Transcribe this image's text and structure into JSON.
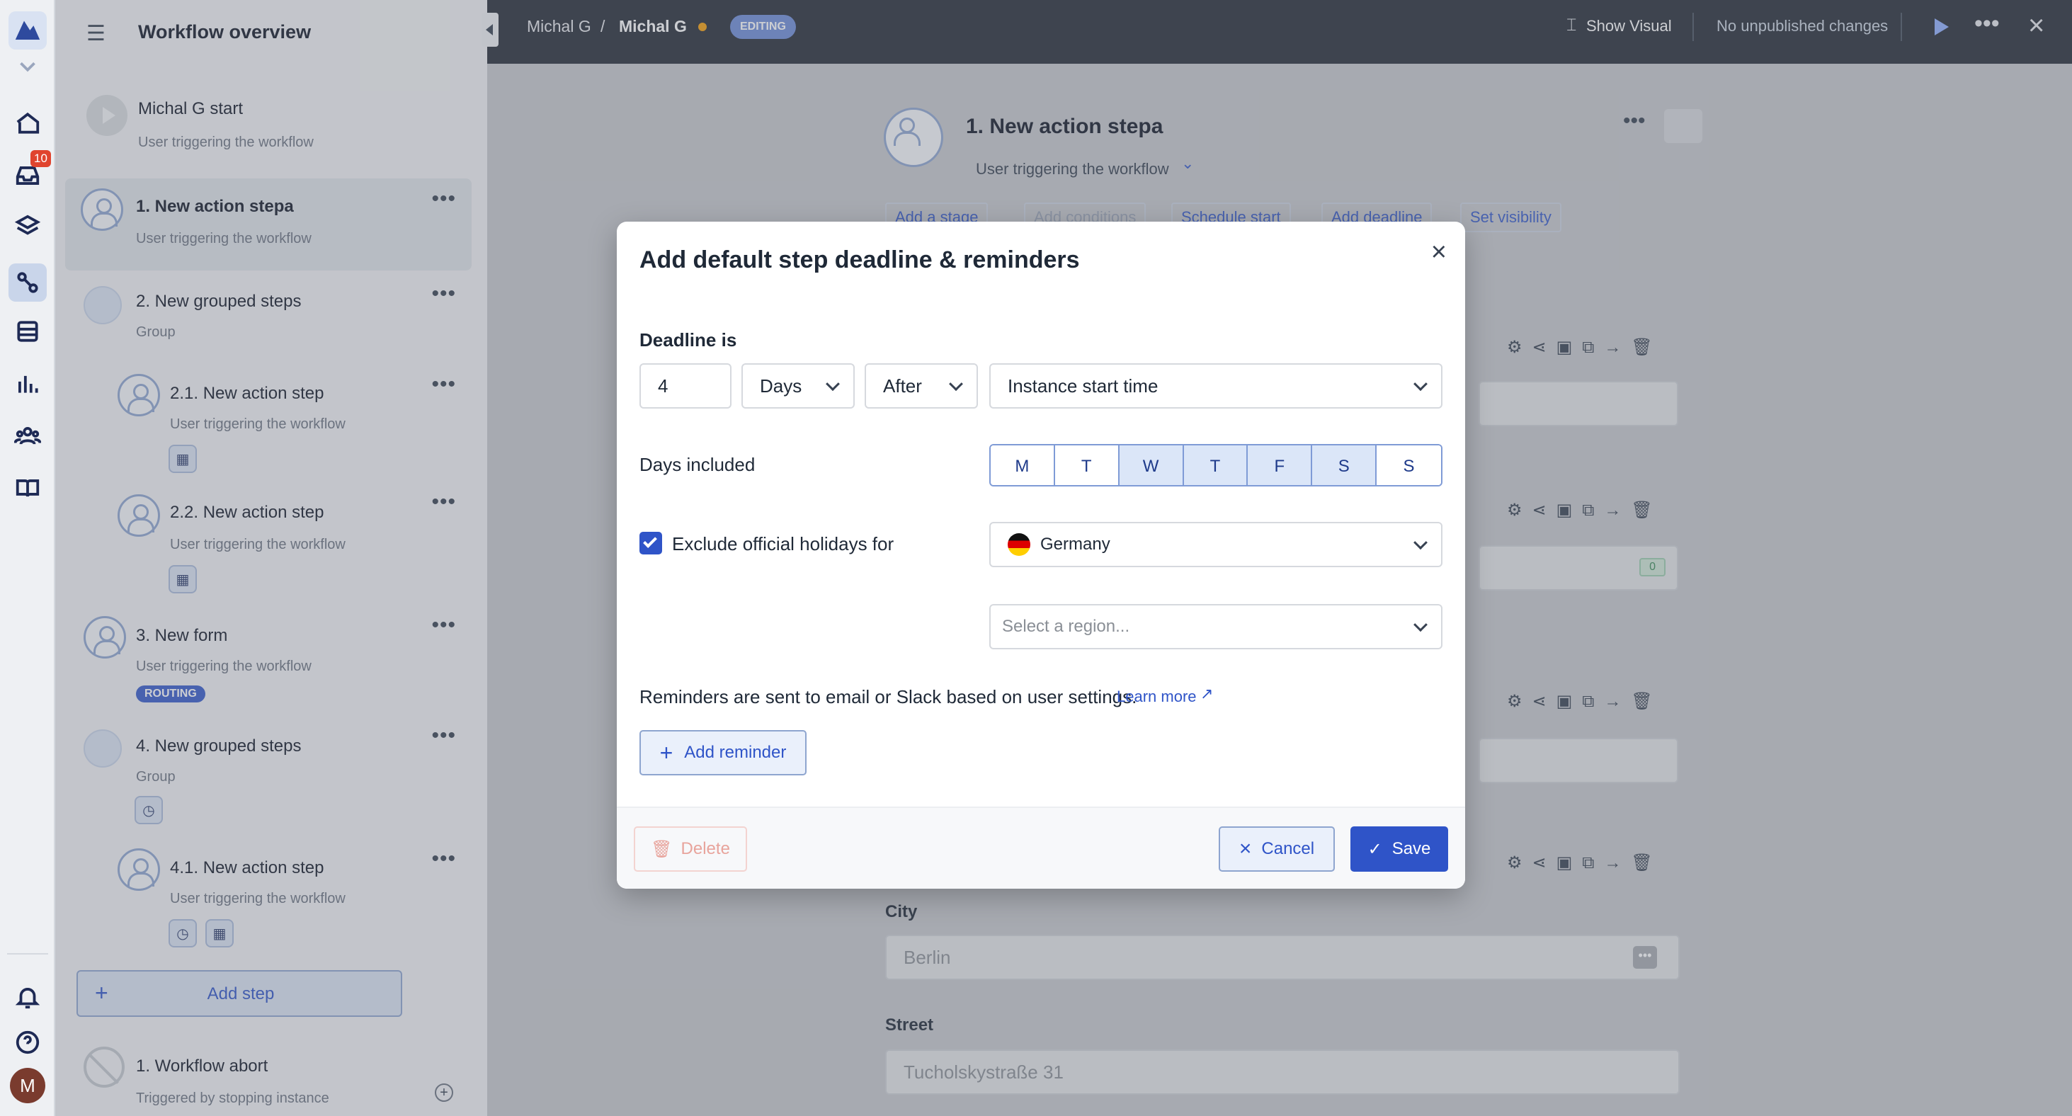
{
  "rail": {
    "badge_count": "10",
    "avatar_initial": "M"
  },
  "panel": {
    "title": "Workflow overview",
    "start": {
      "name": "Michal G start",
      "sub": "User triggering the workflow"
    },
    "steps": [
      {
        "name": "1. New action stepa",
        "sub": "User triggering the workflow"
      },
      {
        "name": "2. New grouped steps",
        "sub": "Group"
      },
      {
        "name": "2.1. New action step",
        "sub": "User triggering the workflow"
      },
      {
        "name": "2.2. New action step",
        "sub": "User triggering the workflow"
      },
      {
        "name": "3. New form",
        "sub": "User triggering the workflow",
        "badge": "ROUTING"
      },
      {
        "name": "4. New grouped steps",
        "sub": "Group"
      },
      {
        "name": "4.1. New action step",
        "sub": "User triggering the workflow"
      }
    ],
    "add_step": "Add step",
    "abort": {
      "name": "1. Workflow abort",
      "sub": "Triggered by stopping instance"
    }
  },
  "topbar": {
    "crumb_1": "Michal G",
    "separator": "/",
    "crumb_2": "Michal G",
    "badge": "EDITING",
    "show_visual": "Show Visual",
    "status": "No unpublished changes"
  },
  "canvas": {
    "step_title": "1. New action stepa",
    "step_sub": "User triggering the workflow",
    "toolbar": [
      "Add a stage",
      "Add conditions",
      "Schedule start",
      "Add deadline",
      "Set visibility"
    ],
    "counter": "0",
    "city_label": "City",
    "city_value": "Berlin",
    "street_label": "Street",
    "street_value": "Tucholskystraße 31"
  },
  "modal": {
    "title": "Add default step deadline & reminders",
    "deadline_label": "Deadline is",
    "amount": "4",
    "unit": "Days",
    "relation": "After",
    "reference": "Instance start time",
    "days_label": "Days included",
    "days": [
      {
        "label": "M",
        "selected": false
      },
      {
        "label": "T",
        "selected": false
      },
      {
        "label": "W",
        "selected": true
      },
      {
        "label": "T",
        "selected": true
      },
      {
        "label": "F",
        "selected": true
      },
      {
        "label": "S",
        "selected": true
      },
      {
        "label": "S",
        "selected": false
      }
    ],
    "holiday_label": "Exclude official holidays for",
    "holiday_checked": true,
    "country": "Germany",
    "region_placeholder": "Select a region...",
    "reminder_text": "Reminders are sent to email or Slack based on user settings.",
    "learn_more": "Learn more",
    "add_reminder": "Add reminder",
    "delete": "Delete",
    "cancel": "Cancel",
    "save": "Save"
  },
  "colors": {
    "accent": "#2f54c8",
    "topbar": "#262b36",
    "selected_day": "#dbe6f8"
  }
}
